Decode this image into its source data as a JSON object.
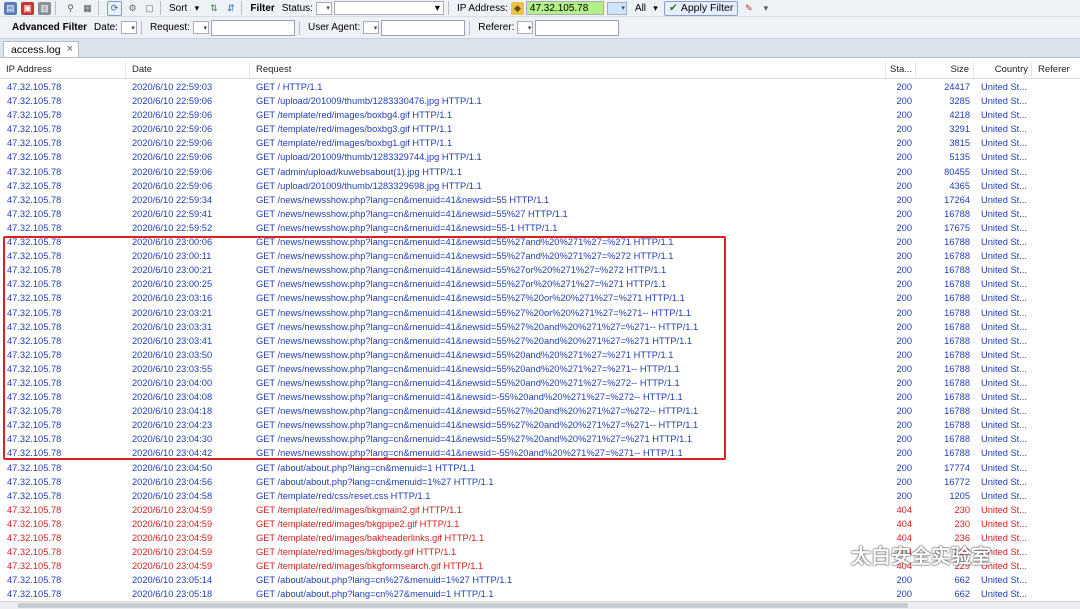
{
  "toolbar": {
    "sort_label": "Sort",
    "filter_label": "Filter",
    "status_label": "Status:",
    "ip_label": "IP Address:",
    "ip_value": "47.32.105.78",
    "all_label": "All",
    "apply_filter_label": "Apply Filter"
  },
  "advanced": {
    "title": "Advanced Filter",
    "date_label": "Date:",
    "request_label": "Request:",
    "useragent_label": "User Agent:",
    "referer_label": "Referer:"
  },
  "tabs": [
    {
      "label": "access.log"
    }
  ],
  "columns": [
    "IP Address",
    "Date",
    "Request",
    "Sta...",
    "Size",
    "Country",
    "Referer"
  ],
  "rows": [
    {
      "ip": "47.32.105.78",
      "date": "2020/6/10 22:59:03",
      "request": "GET / HTTP/1.1",
      "status": "200",
      "size": "24417",
      "country": "United St...",
      "color": "blue"
    },
    {
      "ip": "47.32.105.78",
      "date": "2020/6/10 22:59:06",
      "request": "GET /upload/201009/thumb/1283330476.jpg HTTP/1.1",
      "status": "200",
      "size": "3285",
      "country": "United St...",
      "color": "blue"
    },
    {
      "ip": "47.32.105.78",
      "date": "2020/6/10 22:59:06",
      "request": "GET /template/red/images/boxbg4.gif HTTP/1.1",
      "status": "200",
      "size": "4218",
      "country": "United St...",
      "color": "blue"
    },
    {
      "ip": "47.32.105.78",
      "date": "2020/6/10 22:59:06",
      "request": "GET /template/red/images/boxbg3.gif HTTP/1.1",
      "status": "200",
      "size": "3291",
      "country": "United St...",
      "color": "blue"
    },
    {
      "ip": "47.32.105.78",
      "date": "2020/6/10 22:59:06",
      "request": "GET /template/red/images/boxbg1.gif HTTP/1.1",
      "status": "200",
      "size": "3815",
      "country": "United St...",
      "color": "blue"
    },
    {
      "ip": "47.32.105.78",
      "date": "2020/6/10 22:59:06",
      "request": "GET /upload/201009/thumb/1283329744.jpg HTTP/1.1",
      "status": "200",
      "size": "5135",
      "country": "United St...",
      "color": "blue"
    },
    {
      "ip": "47.32.105.78",
      "date": "2020/6/10 22:59:06",
      "request": "GET /admin/upload/kuwebsabout(1).jpg HTTP/1.1",
      "status": "200",
      "size": "80455",
      "country": "United St...",
      "color": "blue"
    },
    {
      "ip": "47.32.105.78",
      "date": "2020/6/10 22:59:06",
      "request": "GET /upload/201009/thumb/1283329698.jpg HTTP/1.1",
      "status": "200",
      "size": "4365",
      "country": "United St...",
      "color": "blue"
    },
    {
      "ip": "47.32.105.78",
      "date": "2020/6/10 22:59:34",
      "request": "GET /news/newsshow.php?lang=cn&menuid=41&newsid=55 HTTP/1.1",
      "status": "200",
      "size": "17264",
      "country": "United St...",
      "color": "blue"
    },
    {
      "ip": "47.32.105.78",
      "date": "2020/6/10 22:59:41",
      "request": "GET /news/newsshow.php?lang=cn&menuid=41&newsid=55%27 HTTP/1.1",
      "status": "200",
      "size": "16788",
      "country": "United St...",
      "color": "blue"
    },
    {
      "ip": "47.32.105.78",
      "date": "2020/6/10 22:59:52",
      "request": "GET /news/newsshow.php?lang=cn&menuid=41&newsid=55-1 HTTP/1.1",
      "status": "200",
      "size": "17675",
      "country": "United St...",
      "color": "blue"
    },
    {
      "ip": "47.32.105.78",
      "date": "2020/6/10 23:00:06",
      "request": "GET /news/newsshow.php?lang=cn&menuid=41&newsid=55%27and%20%271%27=%271 HTTP/1.1",
      "status": "200",
      "size": "16788",
      "country": "United St...",
      "color": "blue"
    },
    {
      "ip": "47.32.105.78",
      "date": "2020/6/10 23:00:11",
      "request": "GET /news/newsshow.php?lang=cn&menuid=41&newsid=55%27and%20%271%27=%272 HTTP/1.1",
      "status": "200",
      "size": "16788",
      "country": "United St...",
      "color": "blue"
    },
    {
      "ip": "47.32.105.78",
      "date": "2020/6/10 23:00:21",
      "request": "GET /news/newsshow.php?lang=cn&menuid=41&newsid=55%27or%20%271%27=%272 HTTP/1.1",
      "status": "200",
      "size": "16788",
      "country": "United St...",
      "color": "blue"
    },
    {
      "ip": "47.32.105.78",
      "date": "2020/6/10 23:00:25",
      "request": "GET /news/newsshow.php?lang=cn&menuid=41&newsid=55%27or%20%271%27=%271 HTTP/1.1",
      "status": "200",
      "size": "16788",
      "country": "United St...",
      "color": "blue"
    },
    {
      "ip": "47.32.105.78",
      "date": "2020/6/10 23:03:16",
      "request": "GET /news/newsshow.php?lang=cn&menuid=41&newsid=55%27%20or%20%271%27=%271 HTTP/1.1",
      "status": "200",
      "size": "16788",
      "country": "United St...",
      "color": "blue"
    },
    {
      "ip": "47.32.105.78",
      "date": "2020/6/10 23:03:21",
      "request": "GET /news/newsshow.php?lang=cn&menuid=41&newsid=55%27%20or%20%271%27=%271-- HTTP/1.1",
      "status": "200",
      "size": "16788",
      "country": "United St...",
      "color": "blue"
    },
    {
      "ip": "47.32.105.78",
      "date": "2020/6/10 23:03:31",
      "request": "GET /news/newsshow.php?lang=cn&menuid=41&newsid=55%27%20and%20%271%27=%271-- HTTP/1.1",
      "status": "200",
      "size": "16788",
      "country": "United St...",
      "color": "blue"
    },
    {
      "ip": "47.32.105.78",
      "date": "2020/6/10 23:03:41",
      "request": "GET /news/newsshow.php?lang=cn&menuid=41&newsid=55%27%20and%20%271%27=%271 HTTP/1.1",
      "status": "200",
      "size": "16788",
      "country": "United St...",
      "color": "blue"
    },
    {
      "ip": "47.32.105.78",
      "date": "2020/6/10 23:03:50",
      "request": "GET /news/newsshow.php?lang=cn&menuid=41&newsid=55%20and%20%271%27=%271 HTTP/1.1",
      "status": "200",
      "size": "16788",
      "country": "United St...",
      "color": "blue"
    },
    {
      "ip": "47.32.105.78",
      "date": "2020/6/10 23:03:55",
      "request": "GET /news/newsshow.php?lang=cn&menuid=41&newsid=55%20and%20%271%27=%271-- HTTP/1.1",
      "status": "200",
      "size": "16788",
      "country": "United St...",
      "color": "blue"
    },
    {
      "ip": "47.32.105.78",
      "date": "2020/6/10 23:04:00",
      "request": "GET /news/newsshow.php?lang=cn&menuid=41&newsid=55%20and%20%271%27=%272-- HTTP/1.1",
      "status": "200",
      "size": "16788",
      "country": "United St...",
      "color": "blue"
    },
    {
      "ip": "47.32.105.78",
      "date": "2020/6/10 23:04:08",
      "request": "GET /news/newsshow.php?lang=cn&menuid=41&newsid=-55%20and%20%271%27=%272-- HTTP/1.1",
      "status": "200",
      "size": "16788",
      "country": "United St...",
      "color": "blue"
    },
    {
      "ip": "47.32.105.78",
      "date": "2020/6/10 23:04:18",
      "request": "GET /news/newsshow.php?lang=cn&menuid=41&newsid=55%27%20and%20%271%27=%272-- HTTP/1.1",
      "status": "200",
      "size": "16788",
      "country": "United St...",
      "color": "blue"
    },
    {
      "ip": "47.32.105.78",
      "date": "2020/6/10 23:04:23",
      "request": "GET /news/newsshow.php?lang=cn&menuid=41&newsid=55%27%20and%20%271%27=%271-- HTTP/1.1",
      "status": "200",
      "size": "16788",
      "country": "United St...",
      "color": "blue"
    },
    {
      "ip": "47.32.105.78",
      "date": "2020/6/10 23:04:30",
      "request": "GET /news/newsshow.php?lang=cn&menuid=41&newsid=55%27%20and%20%271%27=%271 HTTP/1.1",
      "status": "200",
      "size": "16788",
      "country": "United St...",
      "color": "blue"
    },
    {
      "ip": "47.32.105.78",
      "date": "2020/6/10 23:04:42",
      "request": "GET /news/newsshow.php?lang=cn&menuid=41&newsid=-55%20and%20%271%27=%271-- HTTP/1.1",
      "status": "200",
      "size": "16788",
      "country": "United St...",
      "color": "blue"
    },
    {
      "ip": "47.32.105.78",
      "date": "2020/6/10 23:04:50",
      "request": "GET /about/about.php?lang=cn&menuid=1 HTTP/1.1",
      "status": "200",
      "size": "17774",
      "country": "United St...",
      "color": "blue"
    },
    {
      "ip": "47.32.105.78",
      "date": "2020/6/10 23:04:56",
      "request": "GET /about/about.php?lang=cn&menuid=1%27 HTTP/1.1",
      "status": "200",
      "size": "16772",
      "country": "United St...",
      "color": "blue"
    },
    {
      "ip": "47.32.105.78",
      "date": "2020/6/10 23:04:58",
      "request": "GET /template/red/css/reset.css HTTP/1.1",
      "status": "200",
      "size": "1205",
      "country": "United St...",
      "color": "blue"
    },
    {
      "ip": "47.32.105.78",
      "date": "2020/6/10 23:04:59",
      "request": "GET /template/red/images/bkgmain2.gif HTTP/1.1",
      "status": "404",
      "size": "230",
      "country": "United St...",
      "color": "red"
    },
    {
      "ip": "47.32.105.78",
      "date": "2020/6/10 23:04:59",
      "request": "GET /template/red/images/bkgpipe2.gif HTTP/1.1",
      "status": "404",
      "size": "230",
      "country": "United St...",
      "color": "red"
    },
    {
      "ip": "47.32.105.78",
      "date": "2020/6/10 23:04:59",
      "request": "GET /template/red/images/bakheaderlinks.gif HTTP/1.1",
      "status": "404",
      "size": "236",
      "country": "United St...",
      "color": "red"
    },
    {
      "ip": "47.32.105.78",
      "date": "2020/6/10 23:04:59",
      "request": "GET /template/red/images/bkgbody.gif HTTP/1.1",
      "status": "404",
      "size": "229",
      "country": "United St...",
      "color": "red"
    },
    {
      "ip": "47.32.105.78",
      "date": "2020/6/10 23:04:59",
      "request": "GET /template/red/images/bkgformsearch.gif HTTP/1.1",
      "status": "404",
      "size": "229",
      "country": "United St...",
      "color": "red"
    },
    {
      "ip": "47.32.105.78",
      "date": "2020/6/10 23:05:14",
      "request": "GET /about/about.php?lang=cn%27&menuid=1%27 HTTP/1.1",
      "status": "200",
      "size": "662",
      "country": "United St...",
      "color": "blue"
    },
    {
      "ip": "47.32.105.78",
      "date": "2020/6/10 23:05:18",
      "request": "GET /about/about.php?lang=cn%27&menuid=1 HTTP/1.1",
      "status": "200",
      "size": "662",
      "country": "United St...",
      "color": "blue"
    }
  ],
  "watermark": {
    "text": "太白安全实验室"
  },
  "colors": {
    "row_blue": "#1f3fb3",
    "row_red": "#d51e1e",
    "highlight": "#e02020",
    "ip_field": "#b4f08a"
  }
}
